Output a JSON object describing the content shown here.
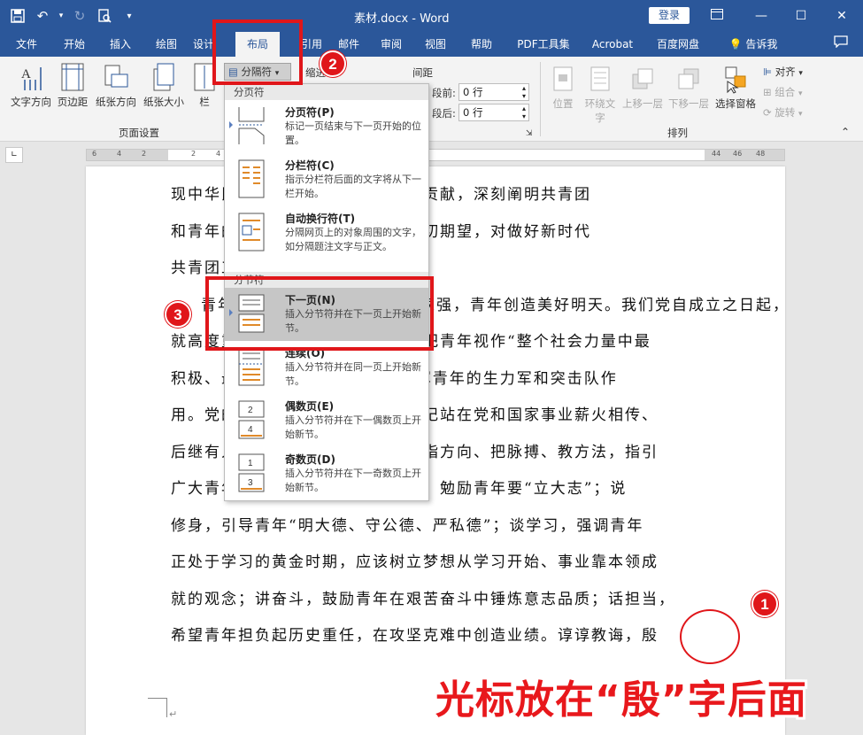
{
  "titlebar": {
    "doc_title": "素材.docx - Word",
    "login": "登录",
    "qat_icons": [
      "save-icon",
      "undo-icon",
      "redo-icon",
      "print-preview-icon",
      "customize-icon"
    ]
  },
  "tabs": [
    {
      "label": "文件"
    },
    {
      "label": "开始"
    },
    {
      "label": "插入"
    },
    {
      "label": "绘图"
    },
    {
      "label": "设计"
    },
    {
      "label": "布局"
    },
    {
      "label": "引用"
    },
    {
      "label": "邮件"
    },
    {
      "label": "审阅"
    },
    {
      "label": "视图"
    },
    {
      "label": "帮助"
    },
    {
      "label": "PDF工具集"
    },
    {
      "label": "Acrobat"
    },
    {
      "label": "百度网盘"
    },
    {
      "label": "告诉我"
    }
  ],
  "ribbon": {
    "page_setup": {
      "label": "页面设置",
      "text_direction": "文字方向",
      "margins": "页边距",
      "orientation": "纸张方向",
      "size": "纸张大小",
      "columns": "栏"
    },
    "breaks_button": "分隔符",
    "indent_label": "缩进",
    "spacing_label": "间距",
    "spacing_before_label": "段前:",
    "spacing_before_value": "0 行",
    "spacing_after_label": "段后:",
    "spacing_after_value": "0 行",
    "arrange": {
      "label": "排列",
      "position": "位置",
      "wrap_text_1": "环绕文",
      "wrap_text_2": "字",
      "bring_forward": "上移一层",
      "send_backward": "下移一层",
      "selection_pane": "选择窗格",
      "align": "对齐",
      "group": "组合",
      "rotate": "旋转"
    }
  },
  "ruler_numbers": [
    "6",
    "4",
    "2",
    "2",
    "4",
    "44",
    "46",
    "48"
  ],
  "dropdown": {
    "page_breaks_header": "分页符",
    "section_breaks_header": "分节符",
    "items": [
      {
        "title": "分页符(P)",
        "desc": "标记一页结束与下一页开始的位置。"
      },
      {
        "title": "分栏符(C)",
        "desc": "指示分栏符后面的文字将从下一栏开始。"
      },
      {
        "title": "自动换行符(T)",
        "desc": "分隔网页上的对象周围的文字，如分隔题注文字与正文。"
      },
      {
        "title": "下一页(N)",
        "desc": "插入分节符并在下一页上开始新节。"
      },
      {
        "title": "连续(O)",
        "desc": "插入分节符并在同一页上开始新节。"
      },
      {
        "title": "偶数页(E)",
        "desc": "插入分节符并在下一偶数页上开始新节。"
      },
      {
        "title": "奇数页(D)",
        "desc": "插入分节符并在下一奇数页上开始新节。"
      }
    ]
  },
  "doc_lines": [
    "现中华民族伟大复兴中作出的重要贡献，深刻阐明共青团",
    "和青年的历史使命，对青年寄予殷切期望，对做好新时代",
    "共青团工作提出明确要求。",
    "青年兴则国家兴，青年强则国家强，青年创造美好明天。我们党自成立之日起，",
    "就高度重视青年工作。毛泽东同志把青年视作“整个社会力量中最",
    "积极、最有生气的力量”，注意发挥青年的生力军和突击队作",
    "用。党的十八大以来，习近平总书记站在党和国家事业薪火相传、",
    "后继有人的战略高度，为青年工作指方向、把脉搏、教方法，指引",
    "广大青年树立远大理想，坚定志向，勉励青年要“立大志”；说",
    "修身，引导青年“明大德、守公德、严私德”；谈学习，强调青年",
    "正处于学习的黄金时期，应该树立梦想从学习开始、事业靠本领成",
    "就的观念；讲奋斗，鼓励青年在艰苦奋斗中锤炼意志品质；话担当，",
    "希望青年担负起历史重任，在攻坚克难中创造业绩。谆谆教诲，殷"
  ],
  "annotations": {
    "badge_1": "1",
    "badge_2": "2",
    "badge_3": "3",
    "caption": "光标放在“殷”字后面"
  },
  "colors": {
    "accent": "#2b579a",
    "annotation_red": "#e0161a"
  }
}
